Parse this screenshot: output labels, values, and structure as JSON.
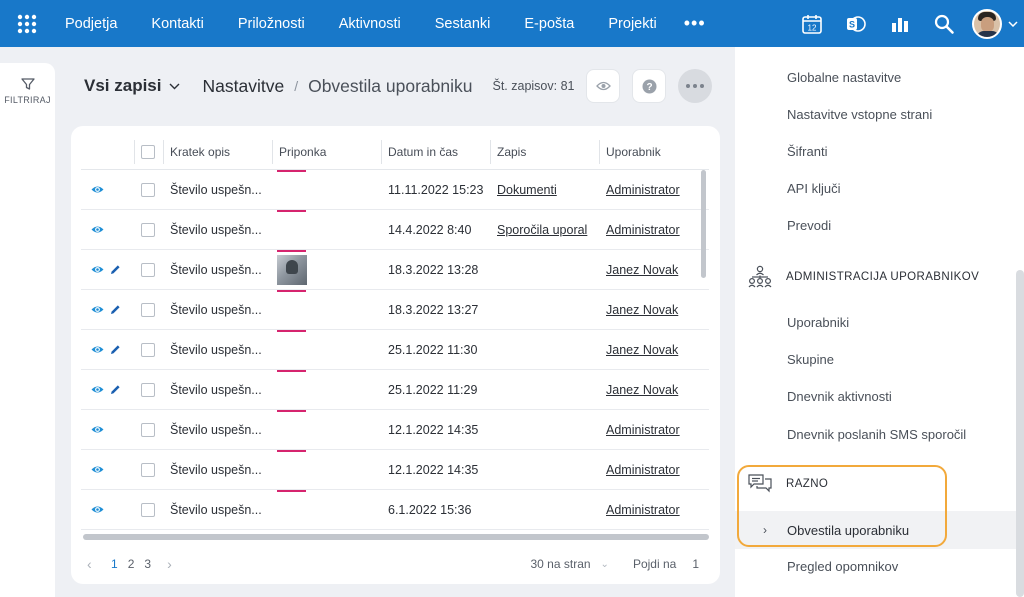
{
  "topbar": {
    "nav": [
      "Podjetja",
      "Kontakti",
      "Priložnosti",
      "Aktivnosti",
      "Sestanki",
      "E-pošta",
      "Projekti"
    ],
    "more": "•••",
    "calendar_day": "12",
    "icons": [
      "apps-grid-icon",
      "calendar-icon",
      "skype-icon",
      "reports-icon",
      "search-icon",
      "user-avatar"
    ]
  },
  "filter": {
    "label": "FILTRIRAJ"
  },
  "header": {
    "view": "Vsi zapisi",
    "crumb_main": "Nastavitve",
    "crumb_sep": "/",
    "crumb_sub": "Obvestila uporabniku",
    "record_count": "Št. zapisov: 81"
  },
  "table": {
    "columns": [
      "Kratek opis",
      "Priponka",
      "Datum in čas",
      "Zapis",
      "Uporabnik"
    ],
    "rows": [
      {
        "desc": "Število uspešn...",
        "date": "11.11.2022 15:23",
        "record": "Dokumenti",
        "user": "Administrator",
        "edit": false,
        "thumb": false
      },
      {
        "desc": "Število uspešn...",
        "date": "14.4.2022 8:40",
        "record": "Sporočila uporal",
        "user": "Administrator",
        "edit": false,
        "thumb": false
      },
      {
        "desc": "Število uspešn...",
        "date": "18.3.2022 13:28",
        "record": "",
        "user": "Janez Novak",
        "edit": true,
        "thumb": true
      },
      {
        "desc": "Število uspešn...",
        "date": "18.3.2022 13:27",
        "record": "",
        "user": "Janez Novak",
        "edit": true,
        "thumb": false
      },
      {
        "desc": "Število uspešn...",
        "date": "25.1.2022 11:30",
        "record": "",
        "user": "Janez Novak",
        "edit": true,
        "thumb": false
      },
      {
        "desc": "Število uspešn...",
        "date": "25.1.2022 11:29",
        "record": "",
        "user": "Janez Novak",
        "edit": true,
        "thumb": false
      },
      {
        "desc": "Število uspešn...",
        "date": "12.1.2022 14:35",
        "record": "",
        "user": "Administrator",
        "edit": false,
        "thumb": false
      },
      {
        "desc": "Število uspešn...",
        "date": "12.1.2022 14:35",
        "record": "",
        "user": "Administrator",
        "edit": false,
        "thumb": false
      },
      {
        "desc": "Število uspešn...",
        "date": "6.1.2022 15:36",
        "record": "",
        "user": "Administrator",
        "edit": false,
        "thumb": false
      }
    ]
  },
  "pager": {
    "prev": "‹",
    "pages": [
      "1",
      "2",
      "3"
    ],
    "active_page": "1",
    "next": "›",
    "per_page": "30 na stran",
    "goto_label": "Pojdi na",
    "goto_value": "1"
  },
  "right_panel": {
    "items_top": [
      "Globalne nastavitve",
      "Nastavitve vstopne strani",
      "Šifranti",
      "API ključi",
      "Prevodi"
    ],
    "section_admin": "ADMINISTRACIJA UPORABNIKOV",
    "items_admin": [
      "Uporabniki",
      "Skupine",
      "Dnevnik aktivnosti",
      "Dnevnik poslanih SMS sporočil"
    ],
    "section_misc": "RAZNO",
    "active_item": "Obvestila uporabniku",
    "items_after": [
      "Pregled opomnikov"
    ]
  },
  "colors": {
    "brand": "#1878c9",
    "eye": "#1f8fd6",
    "pencil": "#1a5fb0",
    "attachment_line": "#d6246e",
    "highlight": "#f2a93b"
  }
}
